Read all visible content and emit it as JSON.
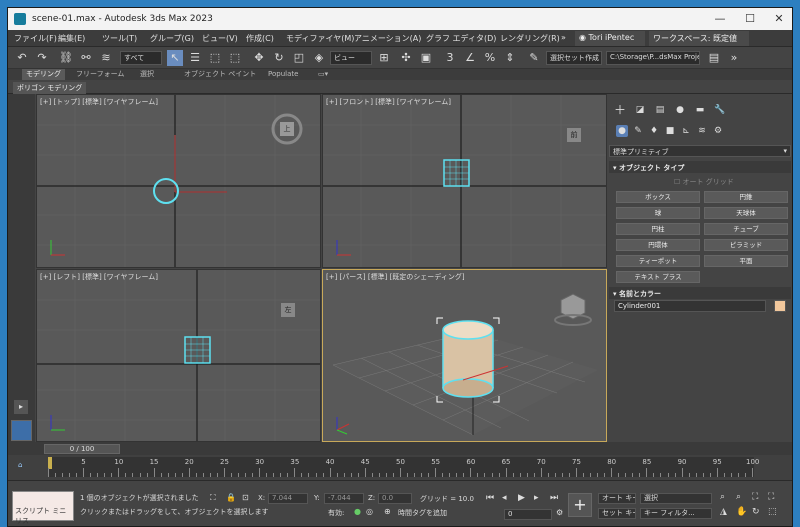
{
  "window": {
    "title": "scene-01.max - Autodesk 3ds Max 2023",
    "minimize": "—",
    "maximize": "☐",
    "close": "✕"
  },
  "menu": [
    "ファイル(F)",
    "編集(E)",
    "ツール(T)",
    "グループ(G)",
    "ビュー(V)",
    "作成(C)",
    "モディファイヤ(M)",
    "アニメーション(A)",
    "グラフ エディタ(D)",
    "レンダリング(R)"
  ],
  "menu_more": "»",
  "user": "Tori iPentec",
  "workspace": "ワークスペース: 既定値",
  "toolbar": {
    "filter_select": "すべて",
    "view_select": "ビュー",
    "selection_set": "選択セット作成",
    "project_path": "C:\\Storage\\P...dsMax Project"
  },
  "ribbon_tabs": [
    "モデリング",
    "フリーフォーム",
    "選択",
    "オブジェクト ペイント",
    "Populate"
  ],
  "ribbon_sub": "ポリゴン モデリング",
  "viewports": {
    "top": {
      "label": "[+] [トップ] [標準] [ワイヤフレーム]",
      "cube": "上"
    },
    "front": {
      "label": "[+] [フロント] [標準] [ワイヤフレーム]",
      "cube": "前"
    },
    "left": {
      "label": "[+] [レフト] [標準] [ワイヤフレーム]",
      "cube": "左"
    },
    "persp": {
      "label": "[+] [パース] [標準] [既定のシェーディング]"
    }
  },
  "command_panel": {
    "dropdown": "標準プリミティブ",
    "object_type_header": "▾ オブジェクト タイプ",
    "autogrid": "オート グリッド",
    "buttons": [
      "ボックス",
      "円錐",
      "球",
      "天球体",
      "円柱",
      "チューブ",
      "円環体",
      "ピラミッド",
      "ティーポット",
      "平面",
      "テキスト プラス"
    ],
    "name_color_header": "▾ 名前とカラー",
    "object_name": "Cylinder001",
    "swatch_color": "#f1c79c"
  },
  "timeline": {
    "frame_display": "0 / 100",
    "ticks": [
      "0",
      "5",
      "10",
      "15",
      "20",
      "25",
      "30",
      "35",
      "40",
      "45",
      "50",
      "55",
      "60",
      "65",
      "70",
      "75",
      "80",
      "85",
      "90",
      "95",
      "100"
    ]
  },
  "status": {
    "script_label": "スクリプト ミニ リス",
    "selected_msg": "1 個のオブジェクトが選択されました",
    "hint_msg": "クリックまたはドラッグをして、オブジェクトを選択します",
    "x_label": "X:",
    "x_value": "7.044",
    "y_label": "Y:",
    "y_value": "-7.044",
    "z_label": "Z:",
    "z_value": "0.0",
    "grid": "グリッド = 10.0",
    "enabled_label": "有効:",
    "add_tag": "時間タグを追加",
    "auto_key": "オート キー",
    "set_key": "セット キー",
    "selection_drop": "選択",
    "key_filter": "キー フィルタ...",
    "frame": "0"
  }
}
